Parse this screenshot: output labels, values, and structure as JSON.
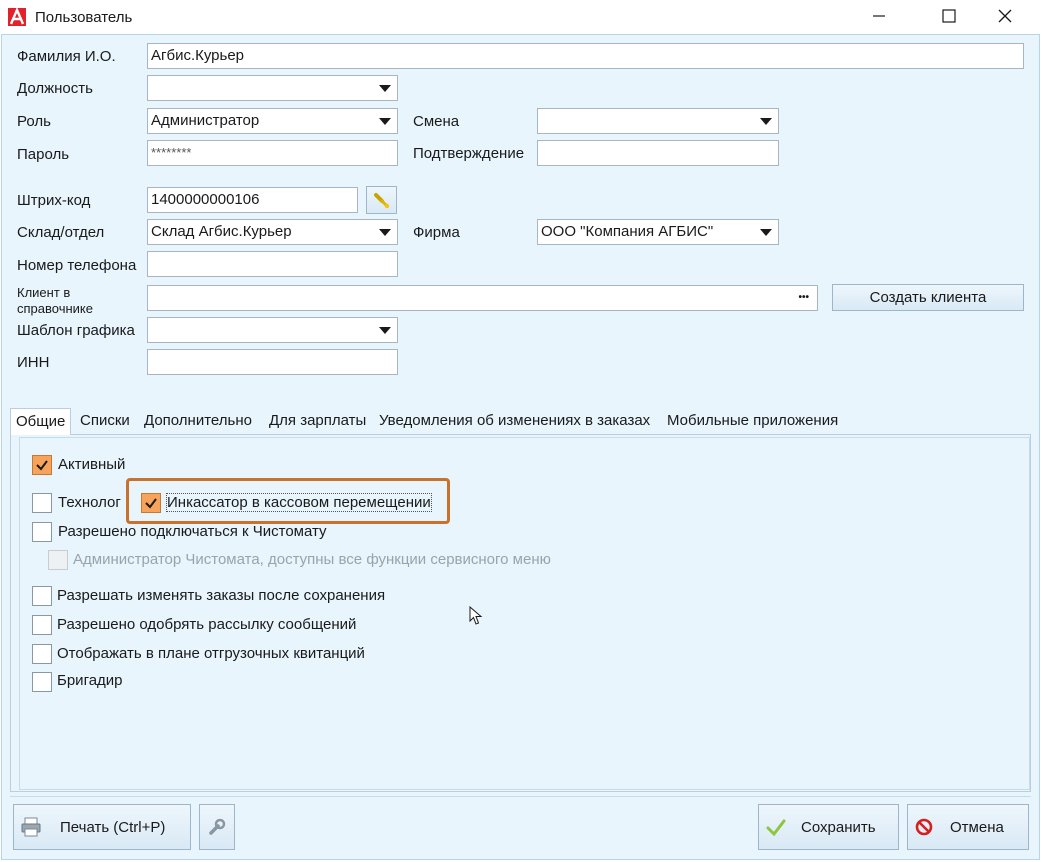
{
  "window": {
    "title": "Пользователь",
    "accent": "#e2212a"
  },
  "form": {
    "fio_label": "Фамилия И.О.",
    "fio_value": "Агбис.Курьер",
    "position_label": "Должность",
    "position_value": "",
    "role_label": "Роль",
    "role_value": "Администратор",
    "shift_label": "Смена",
    "shift_value": "",
    "password_label": "Пароль",
    "password_value": "********",
    "confirm_label": "Подтверждение",
    "confirm_value": "",
    "barcode_label": "Штрих-код",
    "barcode_value": "1400000000106",
    "warehouse_label": "Склад/отдел",
    "warehouse_value": "Склад Агбис.Курьер",
    "firm_label": "Фирма",
    "firm_value": "ООО \"Компания АГБИС\"",
    "phone_label": "Номер телефона",
    "phone_value": "",
    "client_label": "Клиент в справочнике",
    "client_value": "",
    "client_dots": "•••",
    "create_client_label": "Создать клиента",
    "schedule_label": "Шаблон графика",
    "schedule_value": "",
    "inn_label": "ИНН",
    "inn_value": ""
  },
  "tabs": [
    {
      "label": "Общие"
    },
    {
      "label": "Списки"
    },
    {
      "label": "Дополнительно"
    },
    {
      "label": "Для зарплаты"
    },
    {
      "label": "Уведомления об изменениях в заказах"
    },
    {
      "label": "Мобильные приложения"
    }
  ],
  "checkboxes": {
    "active": {
      "label": "Активный",
      "checked": true
    },
    "technolog": {
      "label": "Технолог",
      "checked": false
    },
    "collector": {
      "label": "Инкассатор в кассовом перемещении",
      "checked": true
    },
    "chistomat": {
      "label": "Разрешено подключаться к Чистомату",
      "checked": false
    },
    "chistomat_admin": {
      "label": "Администратор Чистомата, доступны все функции сервисного меню",
      "checked": false
    },
    "edit_orders": {
      "label": "Разрешать изменять заказы после сохранения",
      "checked": false
    },
    "approve_mailing": {
      "label": "Разрешено одобрять рассылку сообщений",
      "checked": false
    },
    "shipping_plan": {
      "label": "Отображать в плане отгрузочных квитанций",
      "checked": false
    },
    "foreman": {
      "label": "Бригадир",
      "checked": false
    }
  },
  "footer": {
    "print_label": "Печать (Ctrl+P)",
    "save_label": "Сохранить",
    "cancel_label": "Отмена"
  },
  "colors": {
    "checked_fill": "#f7a35c",
    "highlight_border": "#c9722b",
    "panel_bg": "#e8f5fd"
  }
}
